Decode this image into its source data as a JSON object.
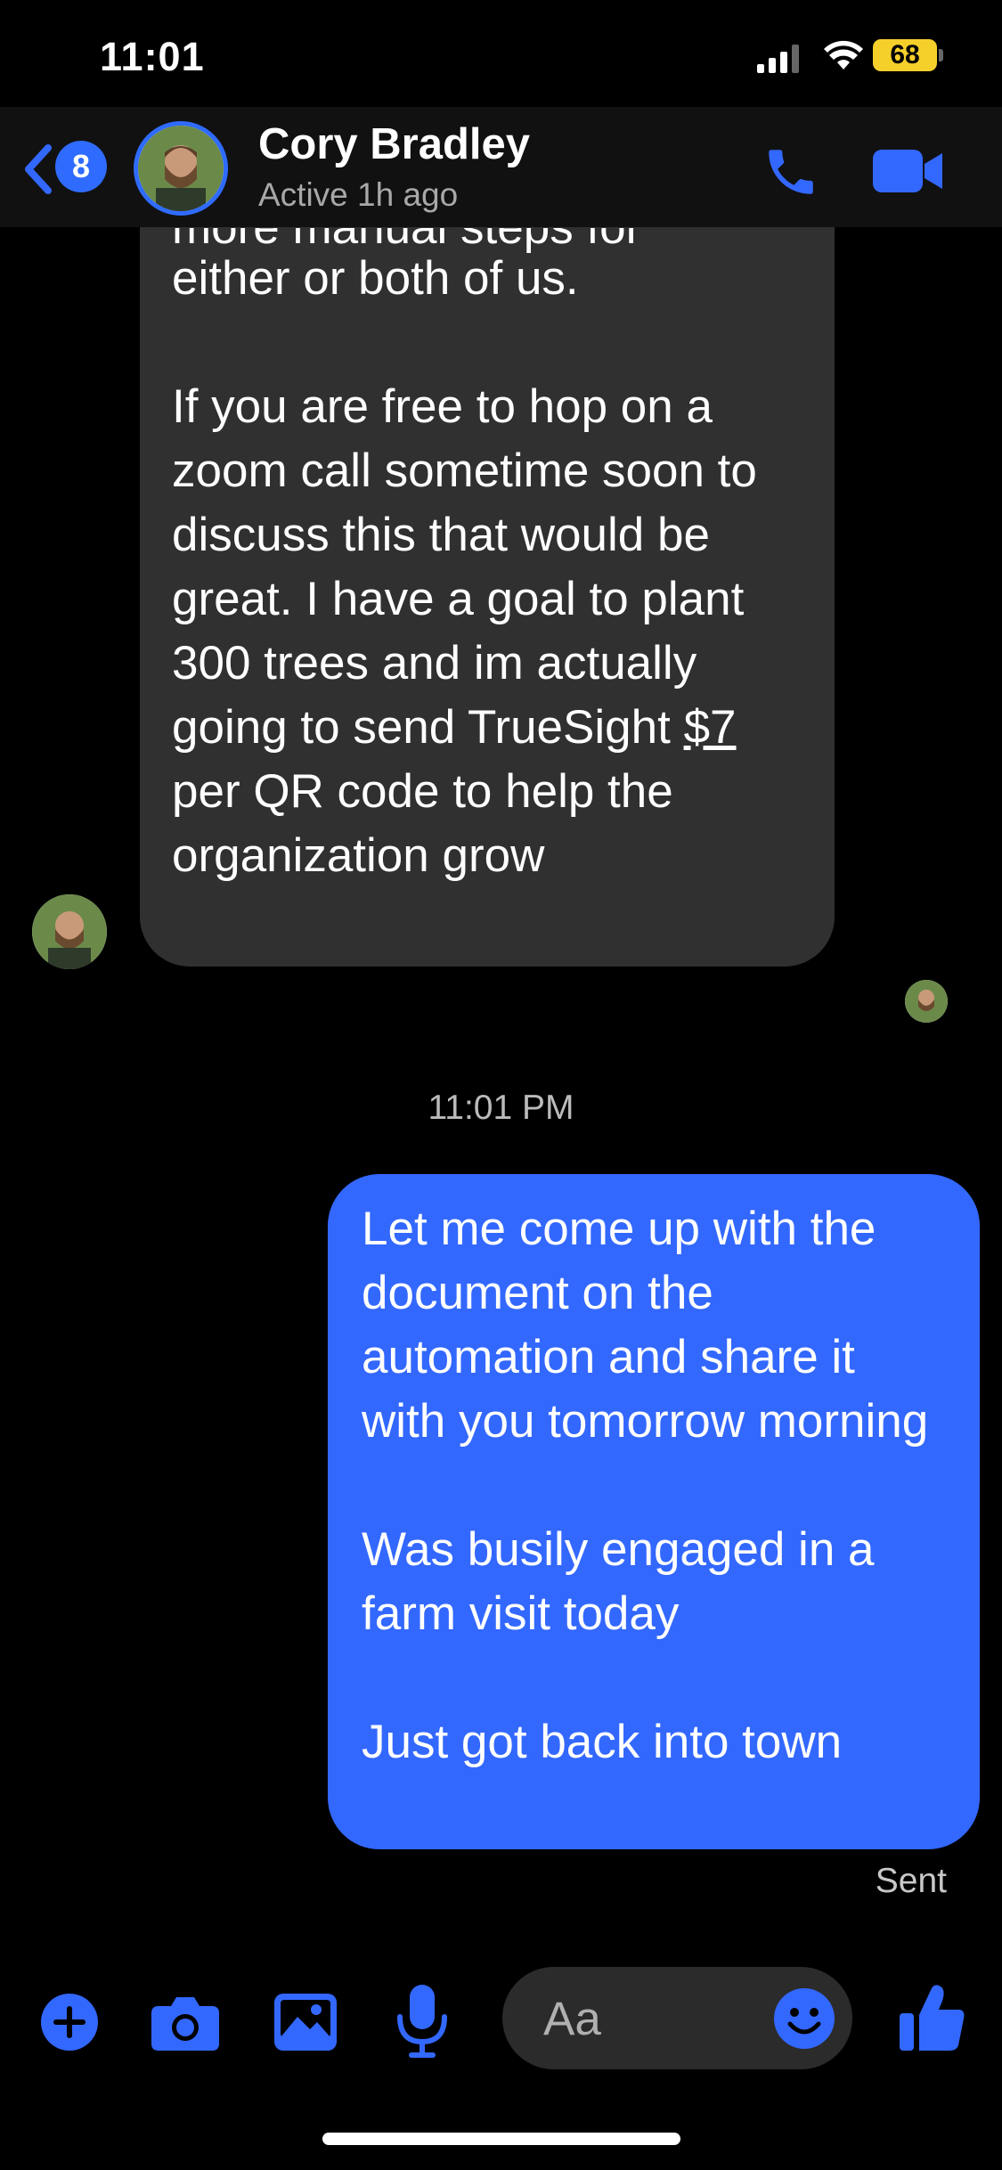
{
  "status_bar": {
    "time": "11:01",
    "battery": "68"
  },
  "header": {
    "unread_count": "8",
    "contact_name": "Cory Bradley",
    "active_status": "Active 1h ago"
  },
  "incoming_message": {
    "partial_line": "more manual steps for",
    "line1": "either or both of us.",
    "para2_before": "If you are free to hop on a zoom call sometime soon to discuss this that would be great. I have a goal to plant 300 trees and im actually going to send TrueSight ",
    "para2_link": "$7",
    "para2_after": " per QR code to help the organization grow"
  },
  "timestamp": "11:01 PM",
  "outgoing_message": {
    "para1": "Let me come up with the document on the automation and share it with you tomorrow morning",
    "para2": "Was busily engaged in a farm visit today",
    "para3": "Just got back into town"
  },
  "delivery_status": "Sent",
  "composer": {
    "placeholder": "Aa"
  },
  "icons": [
    "back-icon",
    "phone-icon",
    "video-icon",
    "plus-icon",
    "camera-icon",
    "image-icon",
    "microphone-icon",
    "emoji-icon",
    "thumbs-up-icon"
  ],
  "colors": {
    "accent": "#3368ff",
    "incoming_bubble": "#303030",
    "background": "#000000"
  }
}
